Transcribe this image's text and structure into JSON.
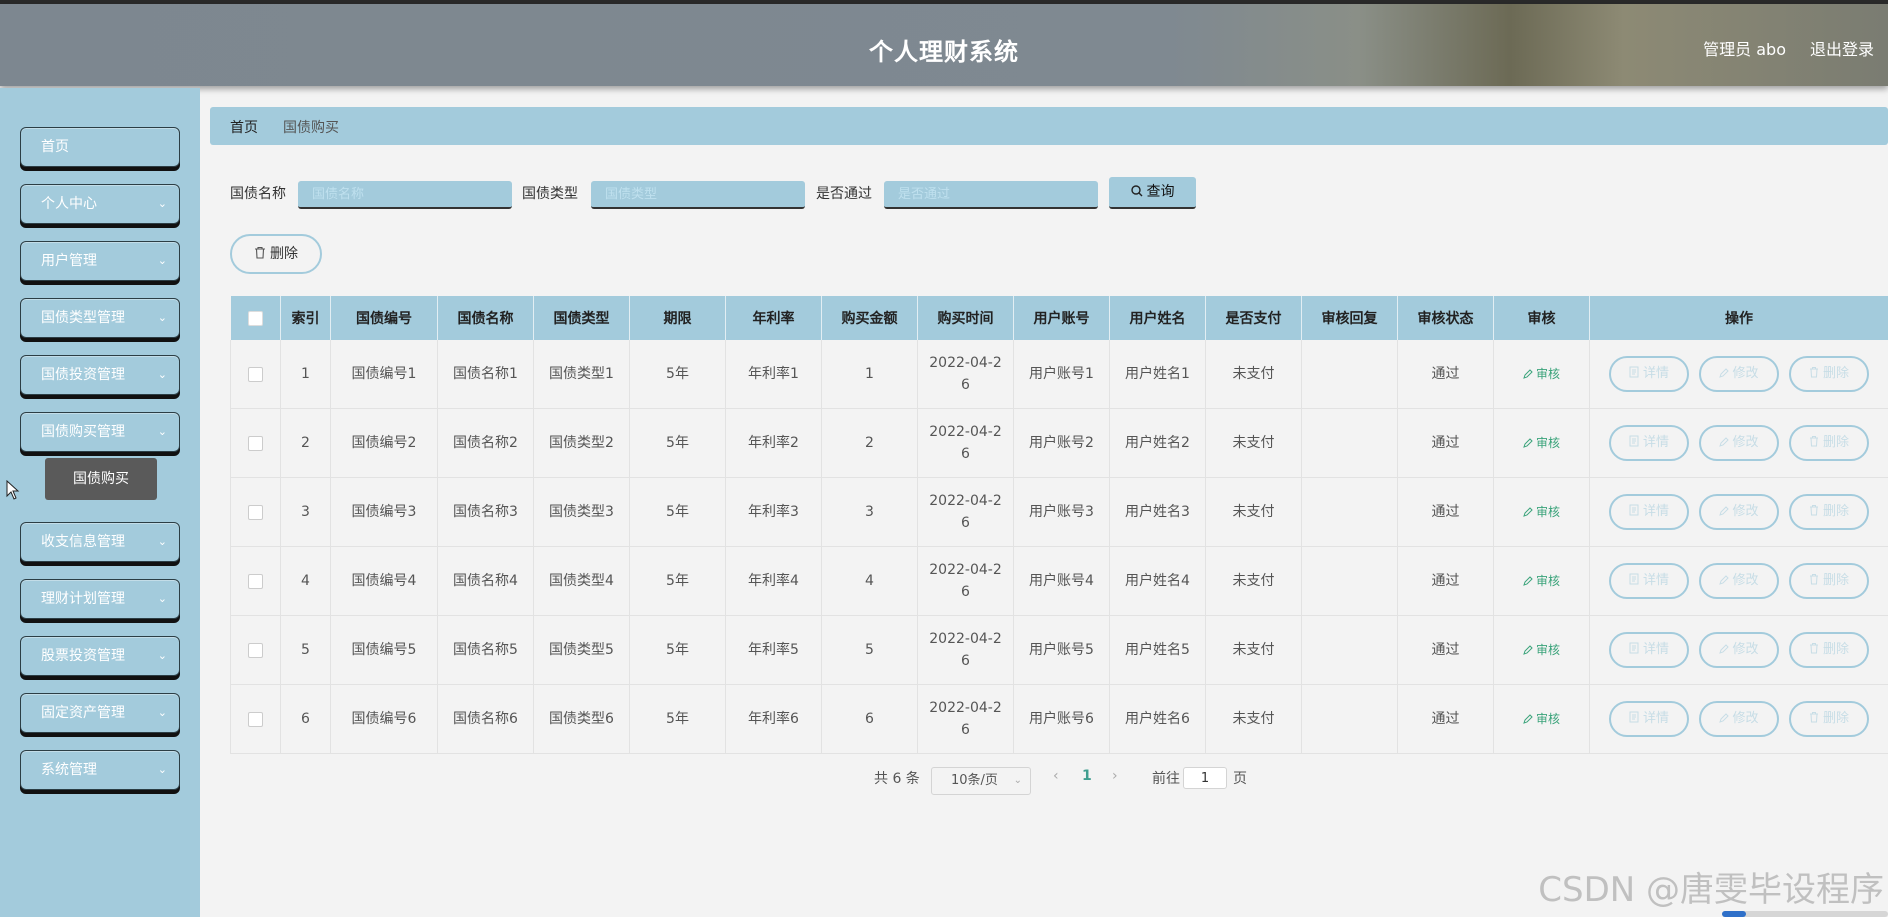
{
  "header": {
    "title": "个人理财系统",
    "user": "管理员 abo",
    "logout": "退出登录"
  },
  "sidebar": {
    "items": [
      {
        "label": "首页",
        "has_arrow": false
      },
      {
        "label": "个人中心",
        "has_arrow": true
      },
      {
        "label": "用户管理",
        "has_arrow": true
      },
      {
        "label": "国债类型管理",
        "has_arrow": true
      },
      {
        "label": "国债投资管理",
        "has_arrow": true
      },
      {
        "label": "国债购买管理",
        "has_arrow": true
      },
      {
        "label": "收支信息管理",
        "has_arrow": true
      },
      {
        "label": "理财计划管理",
        "has_arrow": true
      },
      {
        "label": "股票投资管理",
        "has_arrow": true
      },
      {
        "label": "固定资产管理",
        "has_arrow": true
      },
      {
        "label": "系统管理",
        "has_arrow": true
      }
    ],
    "submenu_active": "国债购买"
  },
  "breadcrumb": {
    "home": "首页",
    "current": "国债购买"
  },
  "search": {
    "fields": [
      {
        "label": "国债名称",
        "placeholder": "国债名称"
      },
      {
        "label": "国债类型",
        "placeholder": "国债类型"
      },
      {
        "label": "是否通过",
        "placeholder": "是否通过"
      }
    ],
    "button": "查询"
  },
  "actions": {
    "delete": "删除"
  },
  "table": {
    "headers": [
      "索引",
      "国债编号",
      "国债名称",
      "国债类型",
      "期限",
      "年利率",
      "购买金额",
      "购买时间",
      "用户账号",
      "用户姓名",
      "是否支付",
      "审核回复",
      "审核状态",
      "审核",
      "操作"
    ],
    "audit_label": "审核",
    "op_labels": {
      "detail": "详情",
      "edit": "修改",
      "delete": "删除"
    },
    "rows": [
      {
        "index": "1",
        "code": "国债编号1",
        "name": "国债名称1",
        "type": "国债类型1",
        "term": "5年",
        "rate": "年利率1",
        "amount": "1",
        "time_a": "2022-04-2",
        "time_b": "6",
        "account": "用户账号1",
        "username": "用户姓名1",
        "paid": "未支付",
        "reply": "",
        "status": "通过"
      },
      {
        "index": "2",
        "code": "国债编号2",
        "name": "国债名称2",
        "type": "国债类型2",
        "term": "5年",
        "rate": "年利率2",
        "amount": "2",
        "time_a": "2022-04-2",
        "time_b": "6",
        "account": "用户账号2",
        "username": "用户姓名2",
        "paid": "未支付",
        "reply": "",
        "status": "通过"
      },
      {
        "index": "3",
        "code": "国债编号3",
        "name": "国债名称3",
        "type": "国债类型3",
        "term": "5年",
        "rate": "年利率3",
        "amount": "3",
        "time_a": "2022-04-2",
        "time_b": "6",
        "account": "用户账号3",
        "username": "用户姓名3",
        "paid": "未支付",
        "reply": "",
        "status": "通过"
      },
      {
        "index": "4",
        "code": "国债编号4",
        "name": "国债名称4",
        "type": "国债类型4",
        "term": "5年",
        "rate": "年利率4",
        "amount": "4",
        "time_a": "2022-04-2",
        "time_b": "6",
        "account": "用户账号4",
        "username": "用户姓名4",
        "paid": "未支付",
        "reply": "",
        "status": "通过"
      },
      {
        "index": "5",
        "code": "国债编号5",
        "name": "国债名称5",
        "type": "国债类型5",
        "term": "5年",
        "rate": "年利率5",
        "amount": "5",
        "time_a": "2022-04-2",
        "time_b": "6",
        "account": "用户账号5",
        "username": "用户姓名5",
        "paid": "未支付",
        "reply": "",
        "status": "通过"
      },
      {
        "index": "6",
        "code": "国债编号6",
        "name": "国债名称6",
        "type": "国债类型6",
        "term": "5年",
        "rate": "年利率6",
        "amount": "6",
        "time_a": "2022-04-2",
        "time_b": "6",
        "account": "用户账号6",
        "username": "用户姓名6",
        "paid": "未支付",
        "reply": "",
        "status": "通过"
      }
    ]
  },
  "pagination": {
    "total": "共 6 条",
    "page_size": "10条/页",
    "prev": "‹",
    "page": "1",
    "next": "›",
    "goto_label": "前往",
    "goto_value": "1",
    "page_unit": "页"
  },
  "watermark": "CSDN @唐雯毕设程序",
  "icons": {
    "search": "search-icon",
    "delete": "trash-icon",
    "detail": "document-icon",
    "edit": "pencil-icon",
    "audit": "pencil-icon",
    "arrow": "chevron-down-icon"
  },
  "colors": {
    "accent": "#a3cbdc",
    "header": "#7f8991",
    "submenu": "#5a5a5a",
    "link": "#3aa37a"
  }
}
